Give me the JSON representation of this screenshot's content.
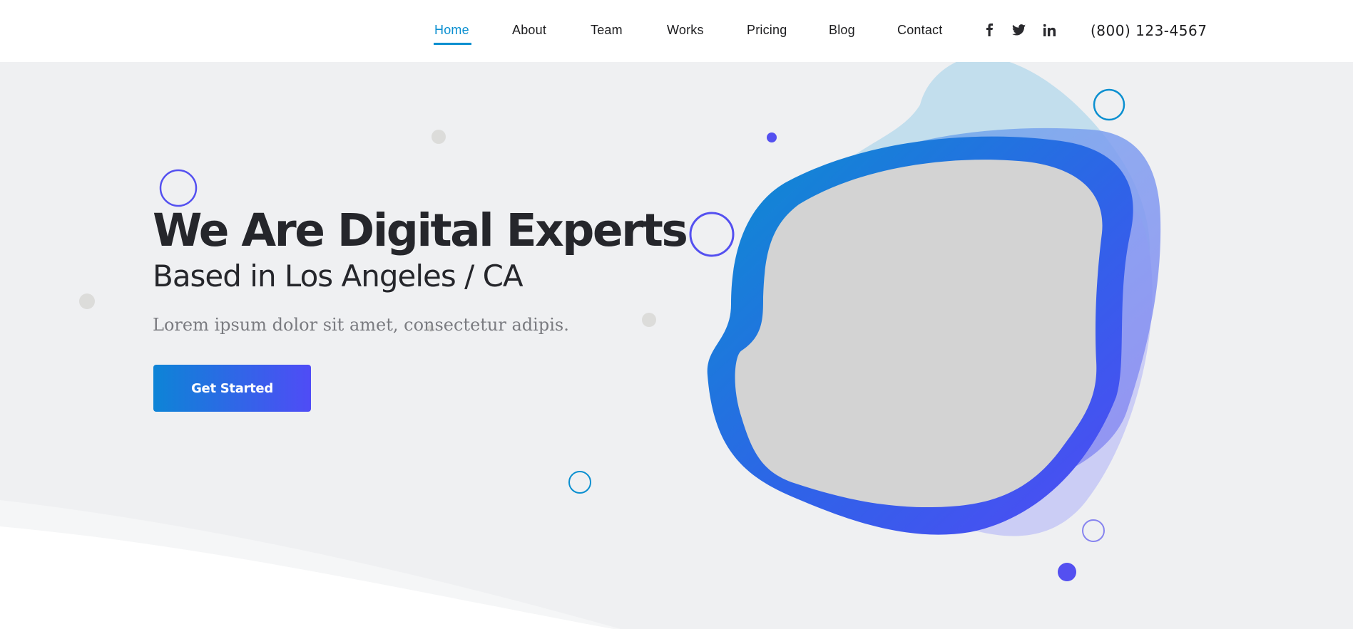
{
  "nav": {
    "items": [
      {
        "label": "Home",
        "active": true
      },
      {
        "label": "About",
        "active": false
      },
      {
        "label": "Team",
        "active": false
      },
      {
        "label": "Works",
        "active": false
      },
      {
        "label": "Pricing",
        "active": false
      },
      {
        "label": "Blog",
        "active": false
      },
      {
        "label": "Contact",
        "active": false
      }
    ],
    "social": [
      "facebook-icon",
      "twitter-icon",
      "linkedin-icon"
    ],
    "phone": "(800) 123-4567"
  },
  "hero": {
    "title": "We Are Digital Experts",
    "subtitle": "Based in Los Angeles / CA",
    "description": "Lorem ipsum dolor sit amet, consectetur adipis.",
    "cta_label": "Get Started"
  },
  "colors": {
    "accent": "#0a8fd0",
    "gradient_start": "#0d84d6",
    "gradient_end": "#4f4cf6",
    "hero_bg": "#eff0f2",
    "text_dark": "#25262b"
  }
}
